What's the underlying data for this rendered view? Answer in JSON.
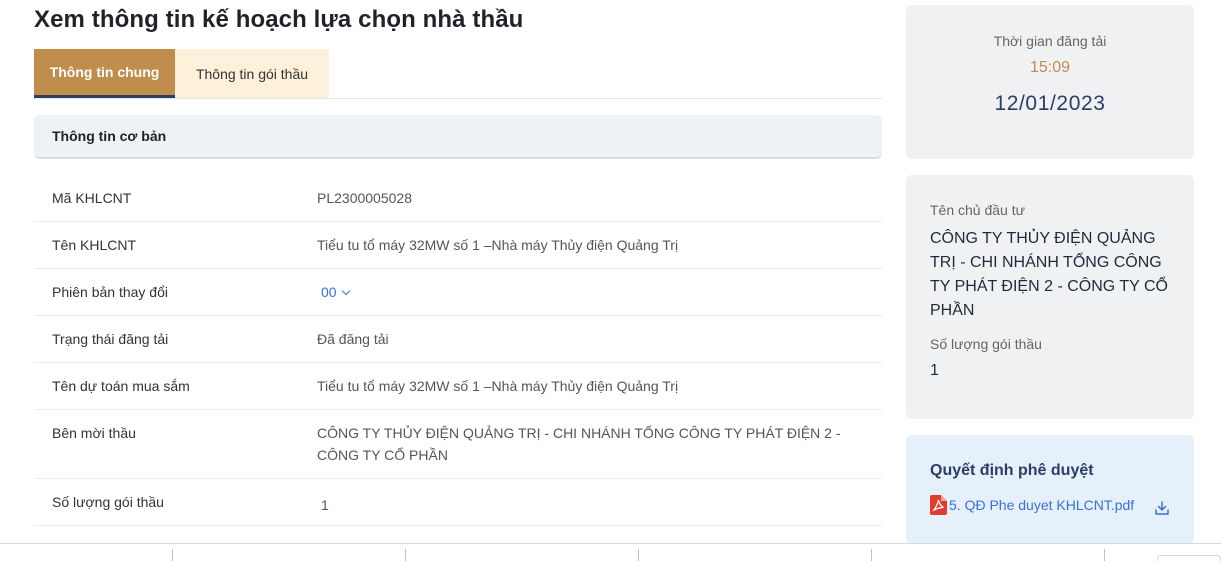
{
  "page_title": "Xem thông tin kế hoạch lựa chọn nhà thầu",
  "tabs": [
    {
      "label": "Thông tin chung",
      "active": true
    },
    {
      "label": "Thông tin gói thầu",
      "active": false
    }
  ],
  "section": {
    "title": "Thông tin cơ bản"
  },
  "rows": [
    {
      "label": "Mã KHLCNT",
      "value": "PL2300005028"
    },
    {
      "label": "Tên KHLCNT",
      "value": "Tiểu tu tổ máy 32MW số 1 –Nhà máy Thủy điện Quảng Trị"
    },
    {
      "label": "Phiên bản thay đổi",
      "value": "00"
    },
    {
      "label": "Trạng thái đăng tải",
      "value": "Đã đăng tải"
    },
    {
      "label": "Tên dự toán mua sắm",
      "value": "Tiểu tu tổ máy 32MW số 1 –Nhà máy Thủy điện Quảng Trị"
    },
    {
      "label": "Bên mời thầu",
      "value": "CÔNG TY THỦY ĐIỆN QUẢNG TRỊ - CHI NHÁNH TỔNG CÔNG TY PHÁT ĐIỆN 2 - CÔNG TY CỔ PHẦN"
    },
    {
      "label": "Số lượng gói thầu",
      "value": "1"
    }
  ],
  "publish": {
    "label": "Thời gian đăng tải",
    "time": "15:09",
    "date": "12/01/2023"
  },
  "owner": {
    "label": "Tên chủ đầu tư",
    "name": "CÔNG TY THỦY ĐIỆN QUẢNG TRỊ - CHI NHÁNH TỔNG CÔNG TY PHÁT ĐIỆN 2 - CÔNG TY CỔ PHẦN",
    "count_label": "Số lượng gói thầu",
    "count_value": "1"
  },
  "decision": {
    "title": "Quyết định phê duyệt",
    "file_name": "5. QĐ Phe duyet KHLCNT.pdf"
  },
  "colors": {
    "accent_gold": "#c08e4c",
    "tab_inactive_bg": "#fdf1dc",
    "navy": "#2c3e66",
    "link_blue": "#3a6fd8",
    "card_gray": "#f0f1f3",
    "card_blue": "#e6f0fb"
  },
  "icons": [
    "chevron-down-icon",
    "pdf-file-icon",
    "download-icon"
  ]
}
